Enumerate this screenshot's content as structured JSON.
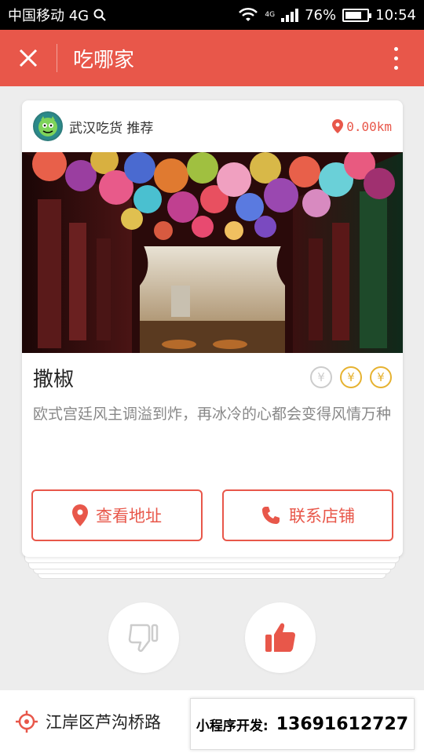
{
  "status_bar": {
    "carrier": "中国移动 4G",
    "network": "4G",
    "battery": "76%",
    "battery_level": 0.76,
    "time": "10:54"
  },
  "header": {
    "title": "吃哪家",
    "close_icon": "close-icon",
    "more_icon": "more-vertical-icon"
  },
  "card": {
    "recommender": "武汉吃货 推荐",
    "distance": "0.00km",
    "restaurant_name": "撒椒",
    "price_level": 2,
    "price_max": 3,
    "price_symbol": "¥",
    "description": "欧式宫廷风主调溢到炸，再冰冷的心都会变得风情万种",
    "view_address_label": "查看地址",
    "contact_store_label": "联系店铺"
  },
  "actions": {
    "dislike_icon": "thumbs-down-icon",
    "like_icon": "thumbs-up-icon"
  },
  "bottom": {
    "location": "江岸区芦沟桥路",
    "promo_prefix": "小程序开发:",
    "promo_phone": "13691612727"
  },
  "colors": {
    "accent": "#e8574a",
    "gold": "#e6b230",
    "status_bar": "#000000"
  }
}
